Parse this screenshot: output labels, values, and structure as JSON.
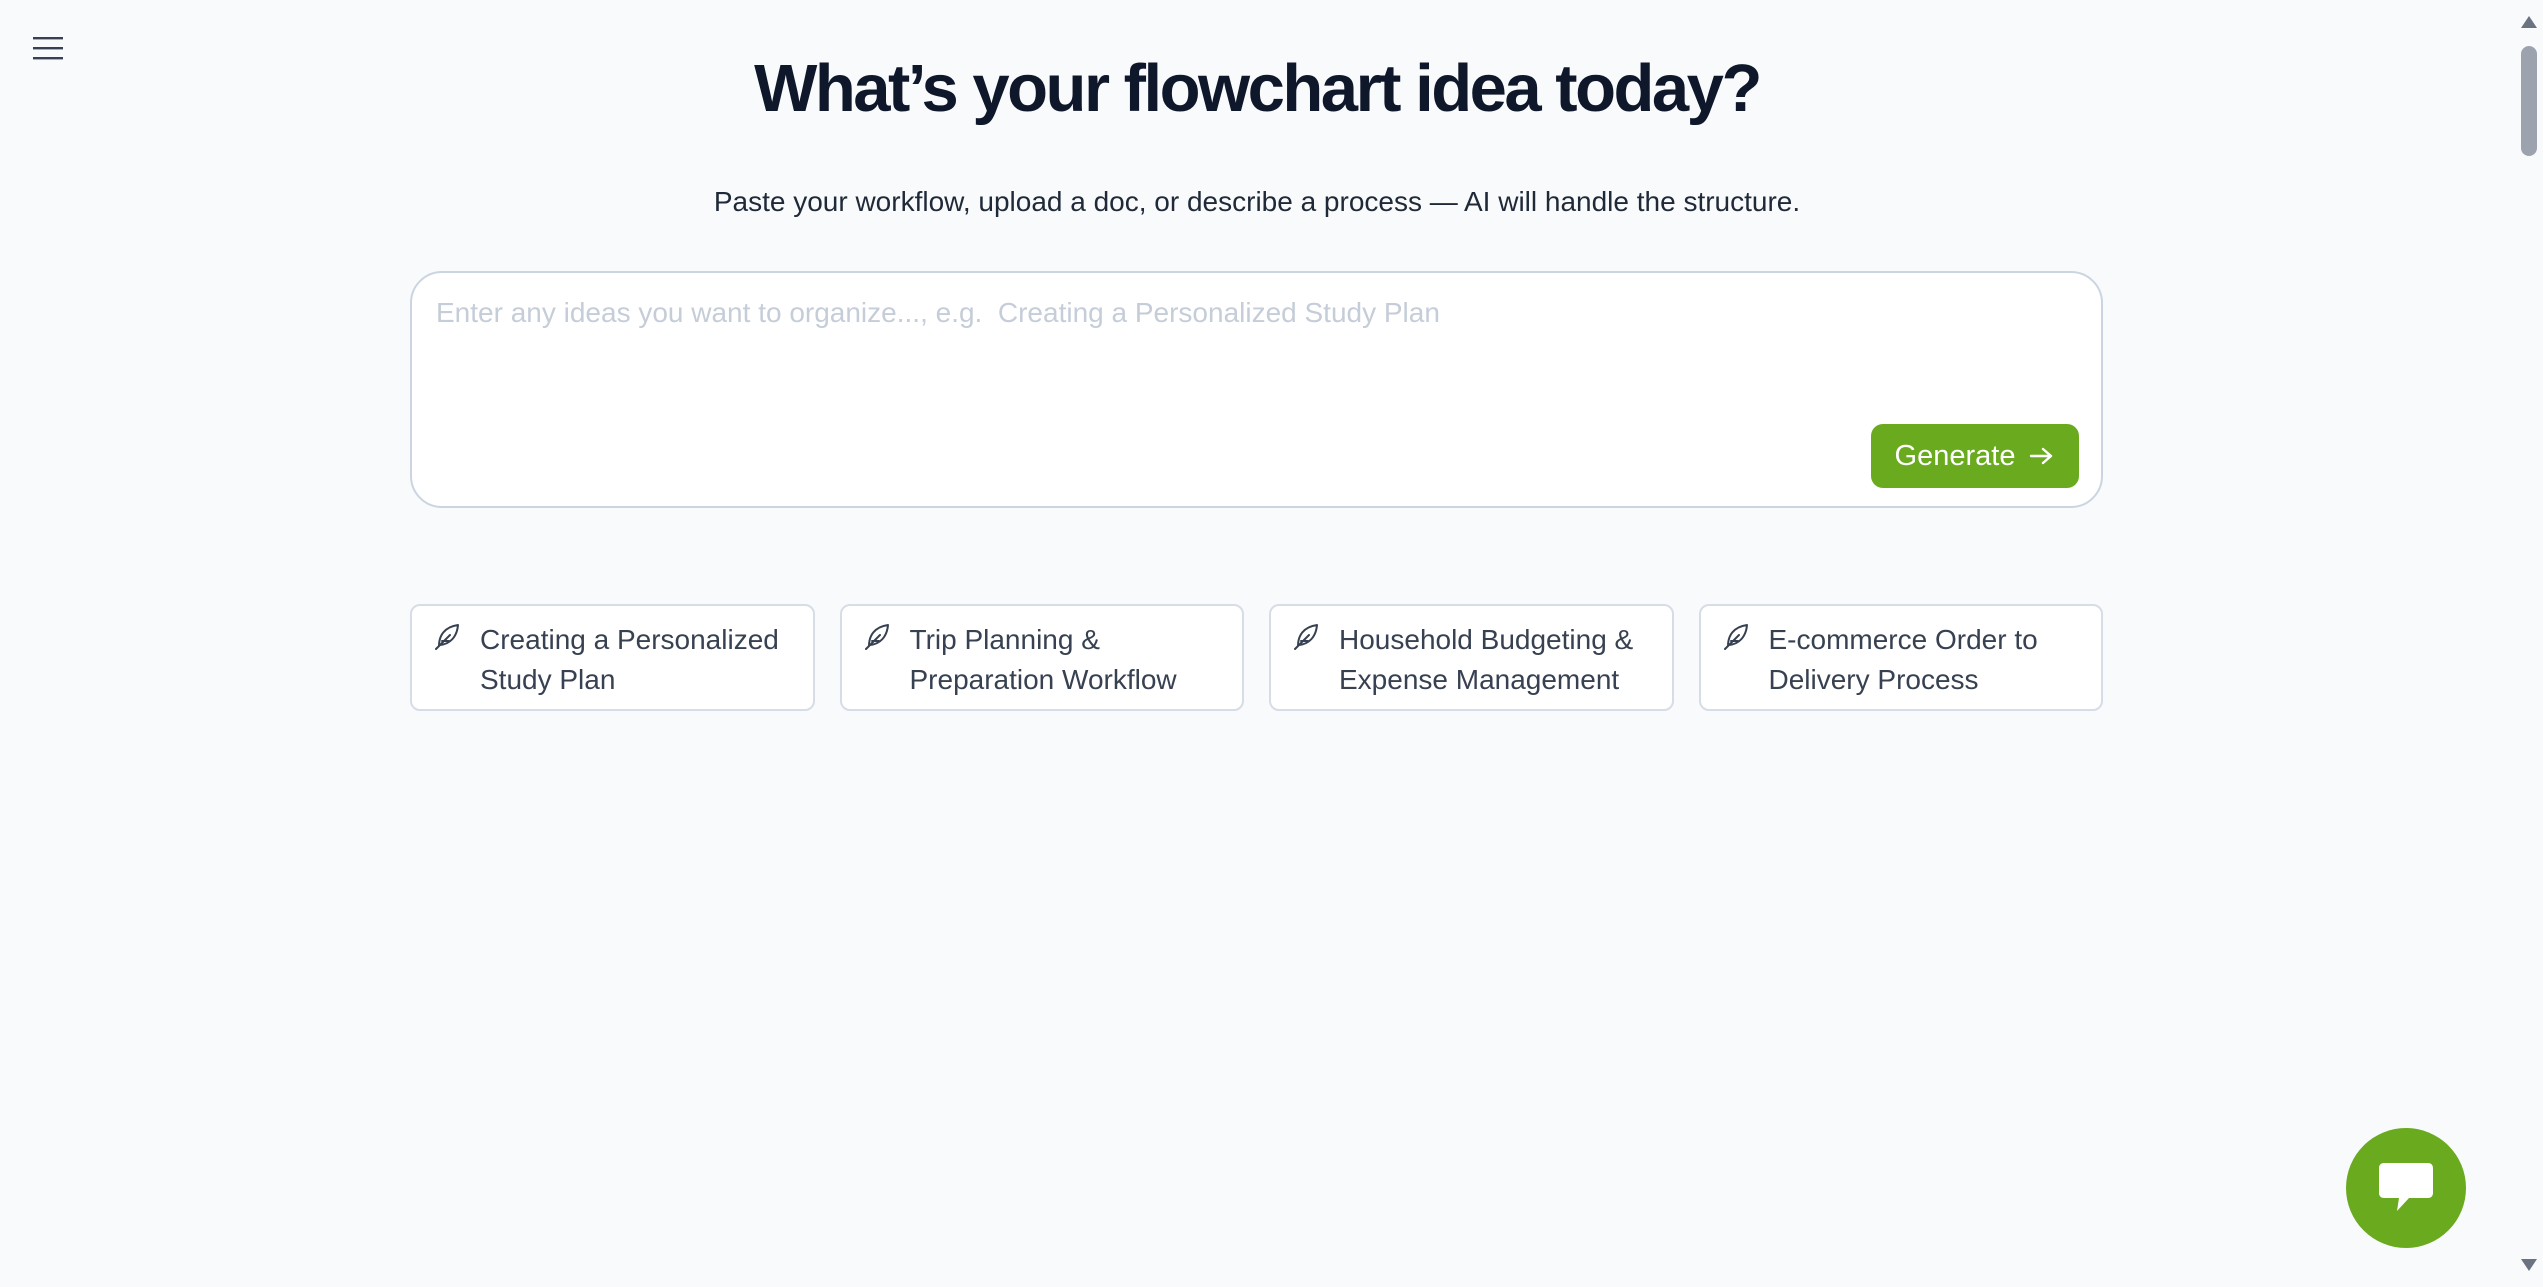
{
  "header": {
    "menu_icon": "hamburger-menu-icon",
    "title": "What’s your flowchart idea today?",
    "subtitle": "Paste your workflow, upload a doc, or describe a process — AI will handle the structure."
  },
  "prompt": {
    "value": "",
    "placeholder": "Enter any ideas you want to organize..., e.g.  Creating a Personalized Study Plan",
    "generate_label": "Generate",
    "generate_icon": "arrow-right-icon"
  },
  "suggestions": [
    {
      "icon": "feather-icon",
      "label": "Creating a Personalized Study Plan"
    },
    {
      "icon": "feather-icon",
      "label": "Trip Planning & Preparation Workflow"
    },
    {
      "icon": "feather-icon",
      "label": "Household Budgeting & Expense Management"
    },
    {
      "icon": "feather-icon",
      "label": "E-commerce Order to Delivery Process"
    }
  ],
  "chat": {
    "icon": "chat-bubble-icon"
  },
  "colors": {
    "accent": "#6aaa1e",
    "background": "#f8fafc",
    "title": "#0f172a",
    "border": "#cbd5e1",
    "placeholder": "#c5cdd8"
  }
}
